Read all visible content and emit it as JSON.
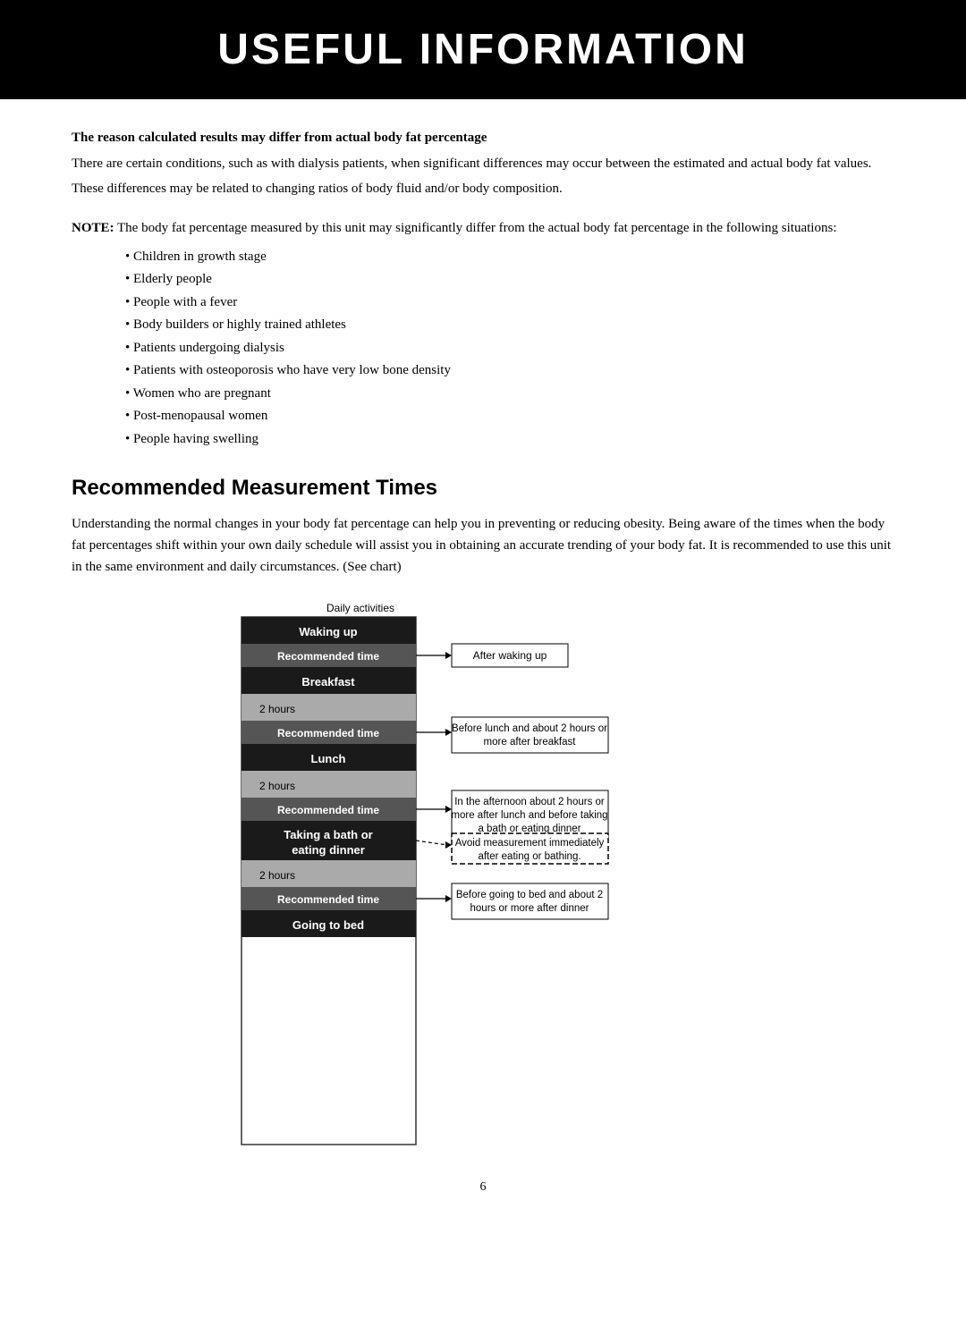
{
  "title": "USEFUL INFORMATION",
  "body_fat_section": {
    "heading": "The reason calculated results may differ from actual body fat percentage",
    "para1": "There are certain conditions, such as with dialysis patients, when significant differences may occur between the estimated and actual body fat values.",
    "para2": "These differences may be related to changing ratios of body fluid and/or body composition.",
    "note_label": "NOTE:",
    "note_text": " The body fat percentage measured by this unit may significantly differ from the actual body fat percentage in the following situations:",
    "bullets": [
      "Children in growth stage",
      "Elderly people",
      "People with a fever",
      "Body builders or highly trained athletes",
      "Patients undergoing dialysis",
      "Patients with osteoporosis who have very low bone density",
      "Women who are pregnant",
      "Post-menopausal women",
      "People having swelling"
    ]
  },
  "rmt": {
    "heading": "Recommended Measurement Times",
    "intro": "Understanding the normal changes in your body fat percentage can help you in preventing or reducing obesity. Being aware of the times when the body fat percentages shift within your own daily schedule will assist you in obtaining an accurate trending of your body fat. It is recommended to use this unit in the same environment and daily circumstances. (See chart)"
  },
  "chart": {
    "daily_activities_label": "Daily activities",
    "rows": [
      {
        "type": "dark",
        "label": "Waking up"
      },
      {
        "type": "rec",
        "label": "Recommended time",
        "annotation": "After waking up",
        "annotation_style": "solid"
      },
      {
        "type": "dark",
        "label": "Breakfast"
      },
      {
        "type": "gray",
        "label": "2 hours"
      },
      {
        "type": "rec",
        "label": "Recommended time",
        "annotation": "Before lunch and about 2 hours or more after breakfast",
        "annotation_style": "solid"
      },
      {
        "type": "dark",
        "label": "Lunch"
      },
      {
        "type": "gray",
        "label": "2 hours"
      },
      {
        "type": "rec",
        "label": "Recommended time",
        "annotation": "In the afternoon about 2 hours or more after lunch and before taking a bath or eating dinner",
        "annotation_style": "solid"
      },
      {
        "type": "dark_multi",
        "label": "Taking a bath or\neating dinner",
        "annotation": "Avoid measurement immediately after eating or bathing.",
        "annotation_style": "dashed"
      },
      {
        "type": "gray",
        "label": "2 hours"
      },
      {
        "type": "rec",
        "label": "Recommended time",
        "annotation": "Before going to bed and about 2 hours or more after dinner",
        "annotation_style": "solid"
      },
      {
        "type": "dark",
        "label": "Going to bed"
      }
    ]
  },
  "page_number": "6"
}
